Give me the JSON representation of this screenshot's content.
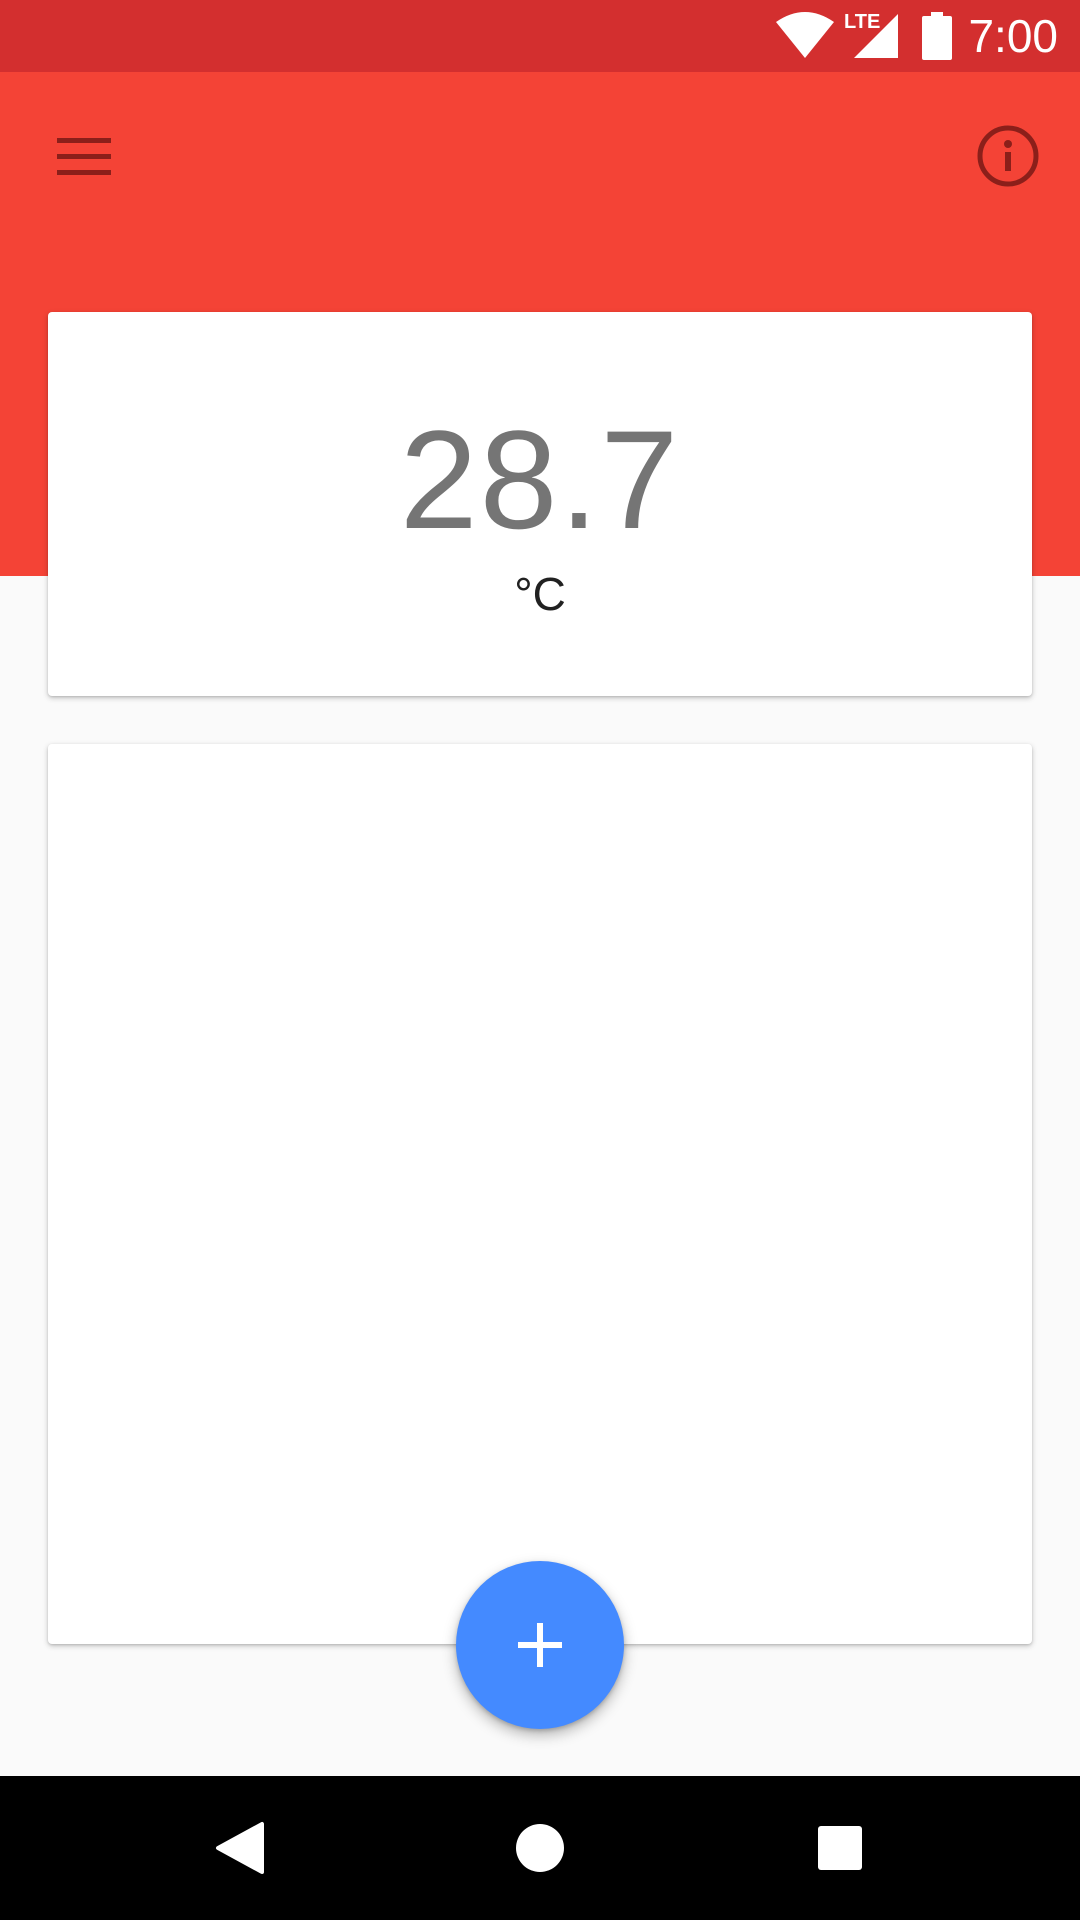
{
  "status_bar": {
    "time": "7:00",
    "icons": [
      "wifi-icon",
      "lte-signal-icon",
      "battery-icon"
    ],
    "network_label": "LTE"
  },
  "app_bar": {
    "left_action": "menu-icon",
    "right_action": "info-icon"
  },
  "temperature_card": {
    "value": "28.7",
    "unit": "°C"
  },
  "fab": {
    "icon": "plus-icon"
  },
  "nav_bar": {
    "buttons": [
      "back-icon",
      "home-icon",
      "recents-icon"
    ]
  },
  "colors": {
    "status_bar": "#d32f2f",
    "app_bar": "#f44336",
    "fab": "#448aff",
    "background": "#fafafa"
  }
}
